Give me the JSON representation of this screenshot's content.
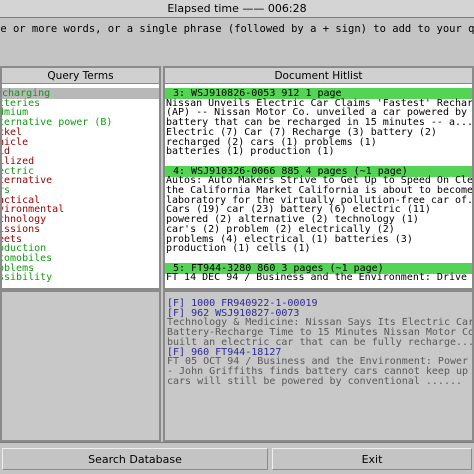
{
  "title": "Elapsed time —— 006:28",
  "instructions": "ne or more words, or a single phrase (followed by a + sign) to add to your query, then pres",
  "query_terms": {
    "header": "Query Terms",
    "items": [
      {
        "label": "charging",
        "color": "green"
      },
      {
        "label": "tteries",
        "color": "green"
      },
      {
        "label": "dmium",
        "color": "green"
      },
      {
        "label": "ternative power (B)",
        "color": "green"
      },
      {
        "label": "ckel",
        "color": "red"
      },
      {
        "label": "nicle",
        "color": "red"
      },
      {
        "label": "id",
        "color": "red"
      },
      {
        "label": "ilized",
        "color": "red"
      },
      {
        "label": "ectric",
        "color": "green"
      },
      {
        "label": "ternative",
        "color": "red"
      },
      {
        "label": "rs",
        "color": "green"
      },
      {
        "label": "actical",
        "color": "red"
      },
      {
        "label": "vironmental",
        "color": "red"
      },
      {
        "label": "chnology",
        "color": "red"
      },
      {
        "label": "issions",
        "color": "red"
      },
      {
        "label": "eets",
        "color": "red"
      },
      {
        "label": "oduction",
        "color": "green"
      },
      {
        "label": "tomobiles",
        "color": "green"
      },
      {
        "label": "oblems",
        "color": "green"
      },
      {
        "label": "ssibility",
        "color": "green"
      }
    ]
  },
  "hitlist": {
    "header": "Document Hitlist",
    "documents": [
      {
        "header": "3:  WSJ910826-0053    912     1 page",
        "lines": [
          "Nissan Unveils Electric Car Claims 'Fastest' Recharg",
          "(AP) -- Nissan Motor Co. unveiled a car powered by",
          "battery that can be recharged in 15 minutes -- a...",
          "Electric (7) Car (7) Recharge (3) battery (2)",
          "recharged (2) cars (1) problems (1)",
          "batteries (1) production (1)"
        ]
      },
      {
        "header": "4:  WSJ910326-0066    885     4 pages (~1 page)",
        "lines": [
          "Autos: Auto Makers Strive to Get Up to Speed On Cle",
          "the California Market California is about to become",
          "laboratory for the virtually pollution-free car of..",
          "Cars (19) car (23) battery (6) electric (11)",
          "powered (2) alternative (2) technology (1)",
          "car's (2) problem (2) electrically (2)",
          "problems (4) electrical (1) batteries (3)",
          "production (1) cells (1)"
        ]
      },
      {
        "header": "5:  FT944-3280       860     3 pages (~1 page)",
        "lines": [
          "FT 14 DEC 94 / Business and the Environment: Drive"
        ]
      }
    ]
  },
  "lower_list": [
    {
      "text": "[F]  1000     FR940922-1-00019",
      "color": "blue"
    },
    {
      "text": "[F]  962      WSJ910827-0073",
      "color": "blue"
    },
    {
      "text": "Technology & Medicine: Nissan Says Its Electric Car",
      "color": "gray"
    },
    {
      "text": "Battery-Recharge Time to 15 Minutes Nissan Motor Co",
      "color": "gray"
    },
    {
      "text": "built an electric car that can be fully recharge...",
      "color": "gray"
    },
    {
      "text": "[F]  960      FT944-18127",
      "color": "blue"
    },
    {
      "text": "FT 05 OCT 94 / Business and the Environment: Power",
      "color": "gray"
    },
    {
      "text": "- John Griffiths finds battery cars cannot keep up",
      "color": "gray"
    },
    {
      "text": "cars will still be powered by conventional ......",
      "color": "gray"
    }
  ],
  "buttons": {
    "search_database": "Search Database",
    "exit": "Exit"
  }
}
